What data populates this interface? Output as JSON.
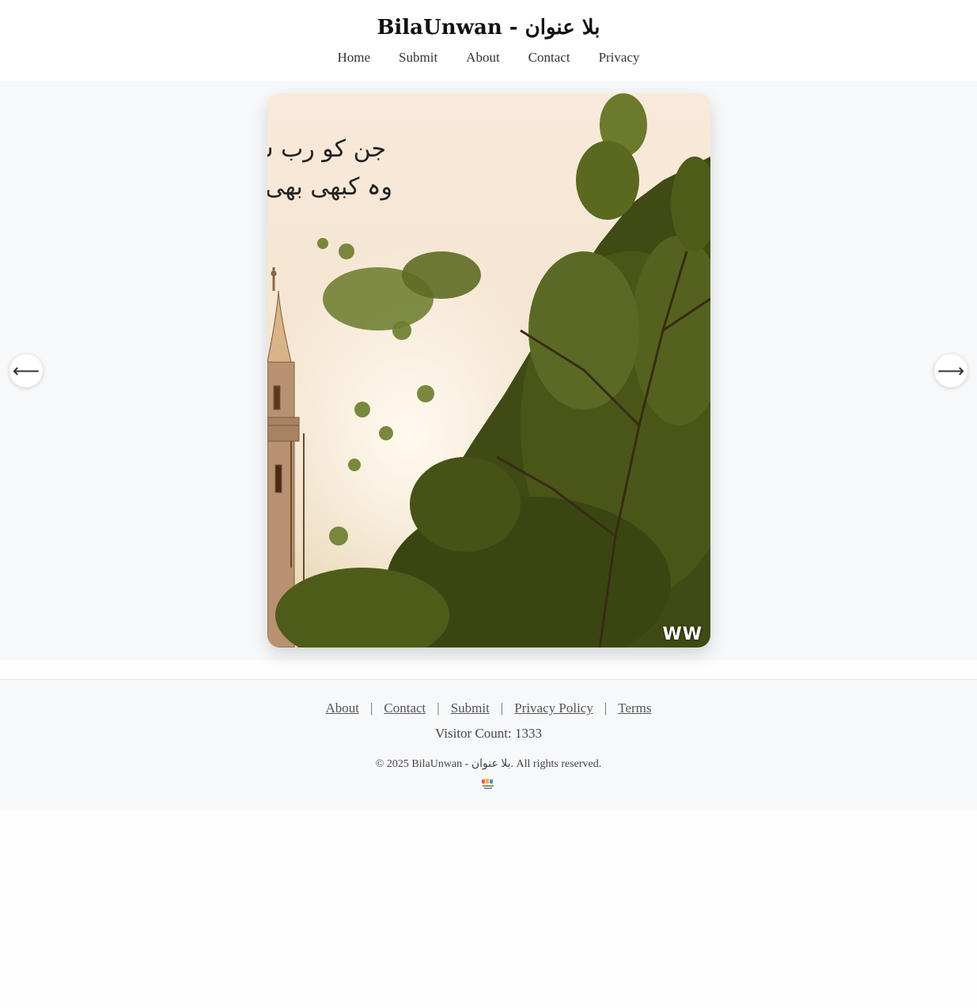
{
  "header": {
    "title": "BilaUnwan - بلا عنوان",
    "nav": [
      "Home",
      "Submit",
      "About",
      "Contact",
      "Privacy"
    ]
  },
  "gallery": {
    "prev_label": "⟵",
    "next_label": "⟶",
    "image_text_line1": "جن کو رب س",
    "image_text_line2": "وہ کبھی بھی",
    "image_watermark": "WW"
  },
  "footer": {
    "links": [
      "About",
      "Contact",
      "Submit",
      "Privacy Policy",
      "Terms"
    ],
    "separator": "|",
    "visitor_count": "Visitor Count: 1333",
    "copyright": "© 2025 BilaUnwan - بلا عنوان. All rights reserved."
  },
  "colors": {
    "page_bg": "#fdfdfd",
    "header_bg": "#ffffff",
    "gallery_bg": "#f7f8fa",
    "footer_bg": "#f7f8fa",
    "link": "#555555"
  }
}
